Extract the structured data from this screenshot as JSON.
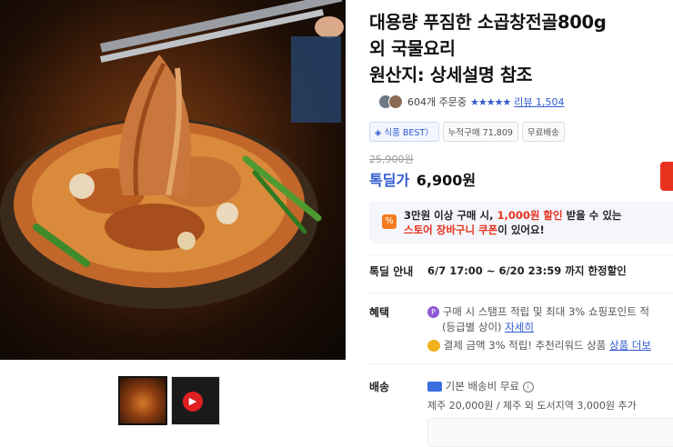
{
  "product": {
    "title": "대용량 푸짐한 소곱창전골800g\n외 국물요리\n원산지: 상세설명 참조",
    "order_count": "604개 주문중",
    "rating_stars": "★★★★★",
    "review_label": "리뷰 1,504",
    "badges": [
      "◈ 식품 BEST〉",
      "누적구매 71,809",
      "무료배송"
    ],
    "original_price": "25,900원",
    "price_label": "톡딜가",
    "price": "6,900원"
  },
  "coupon": {
    "icon": "%",
    "line1_pre": "3만원 이상 구매 시, ",
    "line1_hl": "1,000원 할인",
    "line1_post": " 받을 수 있는",
    "line2_hl": "스토어 장바구니 쿠폰",
    "line2_post": "이 있어요!"
  },
  "deal": {
    "label": "톡딜 안내",
    "text": "6/7 17:00 ~ 6/20 23:59 까지 한정할인"
  },
  "benefit": {
    "label": "혜택",
    "p_icon": "P",
    "line1": "구매 시 스탬프 적립 및 최대 3% 쇼핑포인트 적",
    "line2_pre": "(등급별 상이)",
    "line2_link": "자세히",
    "line3": "결제 금액 3% 적립! 추천리워드 상품",
    "line3_link": "상품 더보"
  },
  "shipping": {
    "label": "배송",
    "line1": "기본 배송비 무료",
    "line2": "제주 20,000원 / 제주 외 도서지역 3,000원 추가"
  },
  "thumbs": {
    "video_badge": "▶"
  },
  "colors": {
    "accent_blue": "#2f5bd1",
    "sale_red": "#e8321e",
    "coupon_orange": "#f47b20"
  }
}
